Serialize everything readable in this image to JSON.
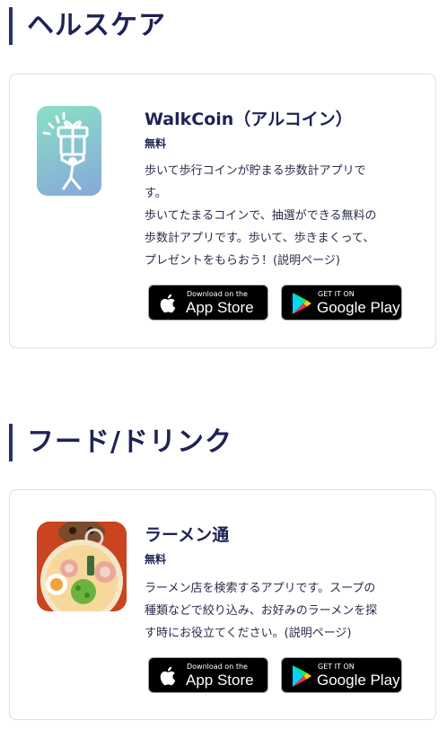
{
  "sections": [
    {
      "title": "ヘルスケア",
      "app": {
        "name": "WalkCoin（アルコイン）",
        "price": "無料",
        "desc_lines": [
          "歩いて歩行コインが貯まる歩数計アプリで",
          "す。",
          "歩いてたまるコインで、抽選ができる無料の",
          "歩数計アプリです。歩いて、歩きまくって、",
          "プレゼントをもらおう！("
        ],
        "link_text": "説明ページ",
        "link_suffix": ")",
        "icon": "walking-gift-icon"
      }
    },
    {
      "title": "フード/ドリンク",
      "app": {
        "name": "ラーメン通",
        "price": "無料",
        "desc_lines": [
          "ラーメン店を検索するアプリです。スープの",
          "種類などで絞り込み、お好みのラーメンを探",
          "す時にお役立てください。("
        ],
        "link_text": "説明ページ",
        "link_suffix": ")",
        "icon": "ramen-bowl-icon"
      }
    }
  ],
  "stores": {
    "apple_small": "Download on the",
    "apple_big": "App Store",
    "google_small": "GET IT ON",
    "google_big": "Google Play"
  }
}
